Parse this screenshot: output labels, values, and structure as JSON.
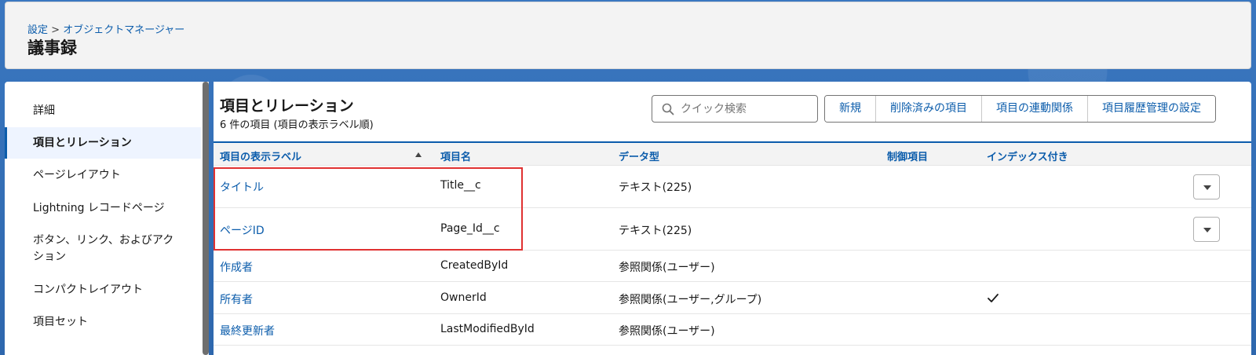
{
  "header": {
    "breadcrumb_root": "設定",
    "breadcrumb_sep": ">",
    "breadcrumb_current": "オブジェクトマネージャー",
    "title": "議事録"
  },
  "sidebar": {
    "items": [
      {
        "label": "詳細"
      },
      {
        "label": "項目とリレーション",
        "active": true
      },
      {
        "label": "ページレイアウト"
      },
      {
        "label": "Lightning レコードページ"
      },
      {
        "label": "ボタン、リンク、およびアク"
      },
      {
        "label": "ション"
      },
      {
        "label": "コンパクトレイアウト"
      },
      {
        "label": "項目セット"
      }
    ]
  },
  "main": {
    "title": "項目とリレーション",
    "subtitle": "6 件の項目 (項目の表示ラベル順)",
    "search": {
      "placeholder": "クイック検索"
    },
    "buttons": {
      "new": "新規",
      "deleted": "削除済みの項目",
      "dependencies": "項目の連動関係",
      "history": "項目履歴管理の設定"
    },
    "columns": {
      "label": "項目の表示ラベル",
      "api": "項目名",
      "type": "データ型",
      "controlling": "制御項目",
      "indexed": "インデックス付き"
    },
    "rows": [
      {
        "label": "タイトル",
        "api": "Title__c",
        "type": "テキスト(225)",
        "indexed": false,
        "menu": true
      },
      {
        "label": "ページID",
        "api": "Page_Id__c",
        "type": "テキスト(225)",
        "indexed": false,
        "menu": true
      },
      {
        "label": "作成者",
        "api": "CreatedById",
        "type": "参照関係(ユーザー)",
        "indexed": false,
        "menu": false
      },
      {
        "label": "所有者",
        "api": "OwnerId",
        "type": "参照関係(ユーザー,グループ)",
        "indexed": true,
        "menu": false
      },
      {
        "label": "最終更新者",
        "api": "LastModifiedById",
        "type": "参照関係(ユーザー)",
        "indexed": false,
        "menu": false
      }
    ]
  },
  "colors": {
    "link": "#0b5cab",
    "highlight": "#e03131",
    "background": "#2f6bb5"
  }
}
